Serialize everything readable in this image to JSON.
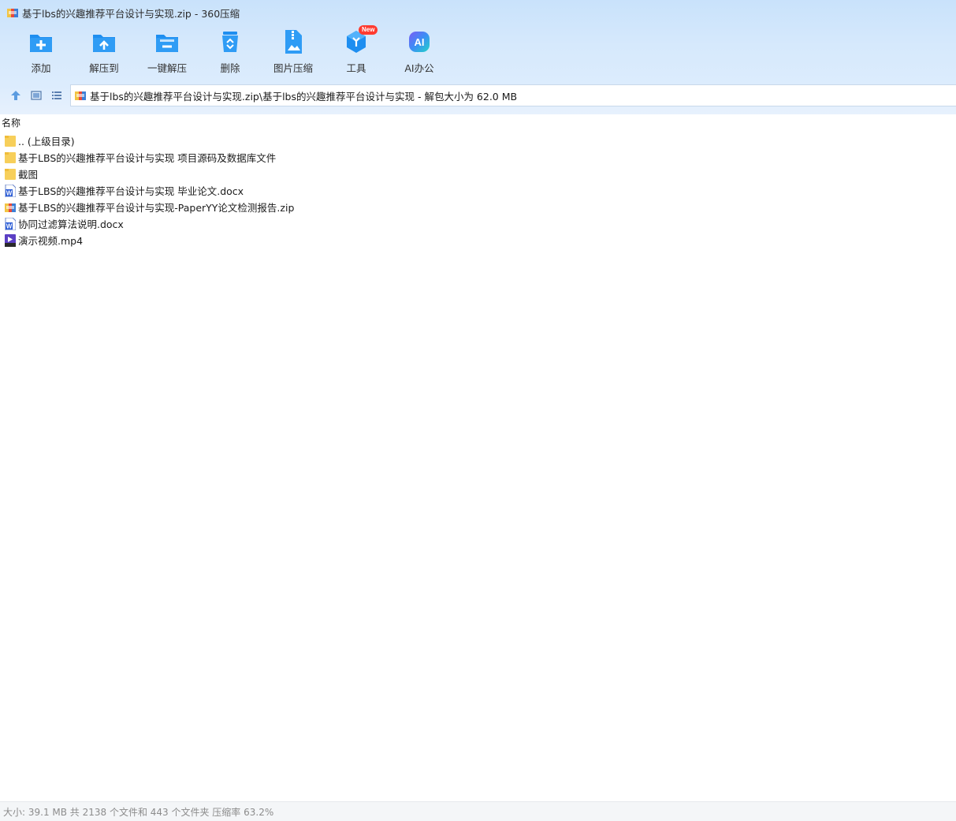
{
  "window": {
    "title": "基于lbs的兴趣推荐平台设计与实现.zip - 360压缩"
  },
  "toolbar": {
    "buttons": [
      {
        "label": "添加",
        "icon": "add-folder-icon"
      },
      {
        "label": "解压到",
        "icon": "extract-to-icon"
      },
      {
        "label": "一键解压",
        "icon": "quick-extract-icon"
      },
      {
        "label": "删除",
        "icon": "recycle-bin-icon"
      },
      {
        "label": "图片压缩",
        "icon": "image-compress-icon"
      },
      {
        "label": "工具",
        "icon": "tools-cube-icon",
        "badge": "New"
      },
      {
        "label": "AI办公",
        "icon": "ai-office-icon"
      }
    ]
  },
  "address": {
    "path": "基于lbs的兴趣推荐平台设计与实现.zip\\基于lbs的兴趣推荐平台设计与实现 - 解包大小为 62.0 MB"
  },
  "list": {
    "column_name": "名称",
    "items": [
      {
        "name": ".. (上级目录)",
        "type": "folder"
      },
      {
        "name": "基于LBS的兴趣推荐平台设计与实现 项目源码及数据库文件",
        "type": "folder"
      },
      {
        "name": "截图",
        "type": "folder"
      },
      {
        "name": "基于LBS的兴趣推荐平台设计与实现 毕业论文.docx",
        "type": "docx"
      },
      {
        "name": "基于LBS的兴趣推荐平台设计与实现-PaperYY论文检测报告.zip",
        "type": "zip"
      },
      {
        "name": "协同过滤算法说明.docx",
        "type": "docx"
      },
      {
        "name": "演示视频.mp4",
        "type": "mp4"
      }
    ]
  },
  "status": {
    "text": "大小: 39.1 MB 共 2138 个文件和 443 个文件夹 压缩率 63.2%"
  },
  "colors": {
    "toolbar_blue": "#1e8ef0",
    "folder_yellow": "#f7cf5a",
    "word_blue": "#2b5cd6",
    "badge_red": "#ff3b30"
  }
}
